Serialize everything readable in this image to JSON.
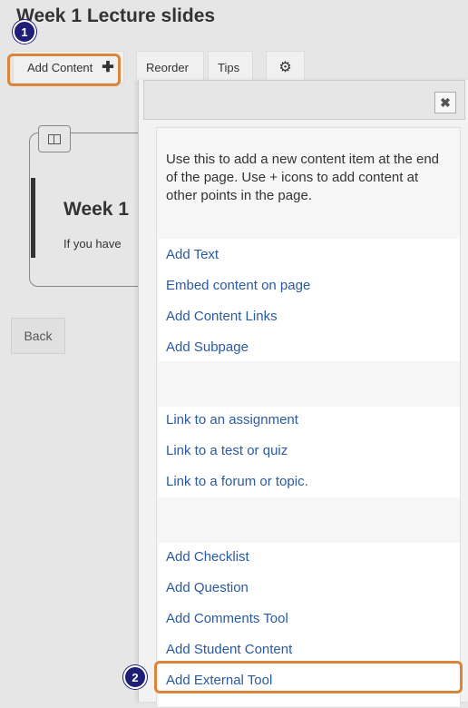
{
  "page": {
    "title": "Week 1 Lecture slides"
  },
  "toolbar": {
    "add_content_label": "Add Content",
    "add_content_icon": "plus-icon",
    "reorder_label": "Reorder",
    "tips_label": "Tips",
    "settings_icon": "gear-icon"
  },
  "content_card": {
    "layout_icon": "layout-columns-icon",
    "title": "Week 1",
    "text": "If you have"
  },
  "back_label": "Back",
  "badges": {
    "step1": "1",
    "step2": "2"
  },
  "dialog": {
    "close_icon": "close-icon",
    "intro": "Use this to add a new content item at the end of the page. Use + icons to add content at other points in the page.",
    "groups": [
      {
        "items": [
          "Add Text",
          "Embed content on page",
          "Add Content Links",
          "Add Subpage"
        ]
      },
      {
        "items": [
          "Link to an assignment",
          "Link to a test or quiz",
          "Link to a forum or topic."
        ]
      },
      {
        "items": [
          "Add Checklist",
          "Add Question",
          "Add Comments Tool",
          "Add Student Content",
          "Add External Tool"
        ]
      }
    ]
  },
  "colors": {
    "highlight": "#d9853b",
    "badge": "#1e1e78",
    "link": "#2a5aa3"
  }
}
